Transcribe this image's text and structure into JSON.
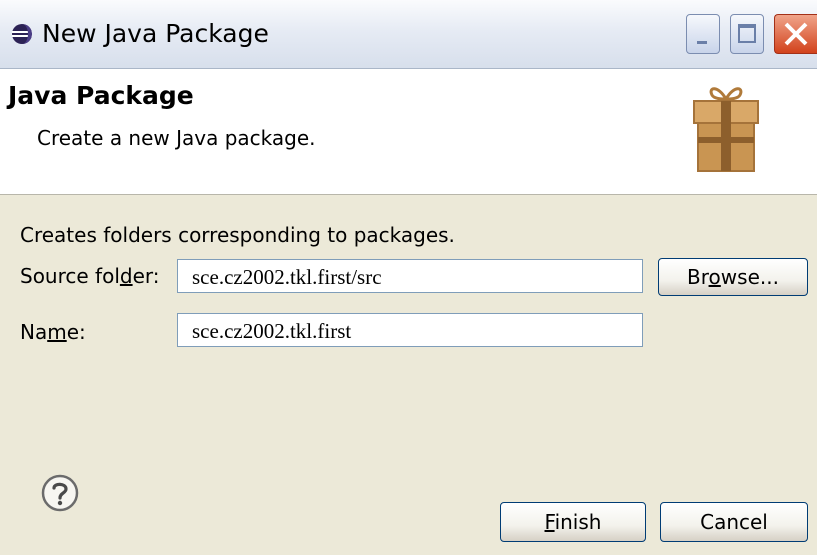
{
  "window": {
    "title": "New Java Package"
  },
  "banner": {
    "title": "Java Package",
    "description": "Create a new Java package."
  },
  "form": {
    "section_description": "Creates folders corresponding to packages.",
    "source_folder": {
      "label_pre": "Source fol",
      "label_mnemonic": "d",
      "label_post": "er:",
      "value": "sce.cz2002.tkl.first/src"
    },
    "name": {
      "label_pre": "Na",
      "label_mnemonic": "m",
      "label_post": "e:",
      "value": "sce.cz2002.tkl.first"
    },
    "browse_button": {
      "label_pre": "Br",
      "label_mnemonic": "o",
      "label_post": "wse..."
    }
  },
  "footer": {
    "help_icon": "question-mark-icon",
    "finish_button": {
      "label_mnemonic": "F",
      "label_post": "inish"
    },
    "cancel_button": {
      "label": "Cancel"
    }
  },
  "colors": {
    "title_bar": "#e6ebf4",
    "close_button": "#d2421c",
    "dialog_background": "#ece9d8",
    "banner_background": "#ffffff",
    "input_border": "#7f9db9",
    "button_border": "#003c74"
  }
}
